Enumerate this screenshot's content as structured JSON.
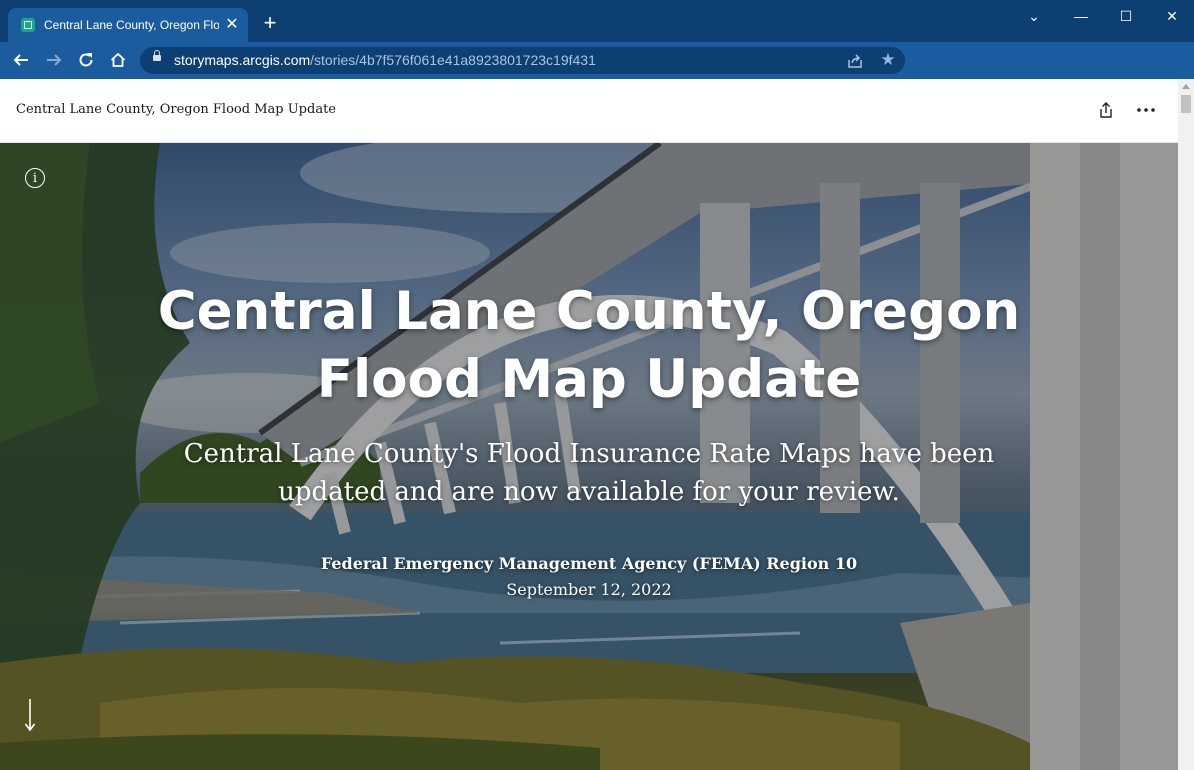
{
  "browser": {
    "tab": {
      "title": "Central Lane County, Oregon Flo",
      "close_glyph": "✕",
      "favicon": "storymaps-icon"
    },
    "new_tab_glyph": "+",
    "window_controls": {
      "minimize": "—",
      "maximize": "☐",
      "close": "✕",
      "tab_search": "⌄"
    },
    "url": {
      "host": "storymaps.arcgis.com",
      "path": "/stories/4b7f576f061e41a8923801723c19f431"
    },
    "colors": {
      "tabbar": "#0d3f72",
      "toolbar": "#1b5c9e",
      "star": "#8fb4f0"
    }
  },
  "story_header": {
    "title": "Central Lane County, Oregon Flood Map Update",
    "more_glyph": "•••"
  },
  "hero": {
    "info_glyph": "i",
    "title": "Central Lane County, Oregon Flood Map Update",
    "subtitle": "Central Lane County's Flood Insurance Rate Maps have been updated and are now available for your review.",
    "byline": "Federal Emergency Management Agency (FEMA) Region 10",
    "date": "September 12, 2022"
  }
}
